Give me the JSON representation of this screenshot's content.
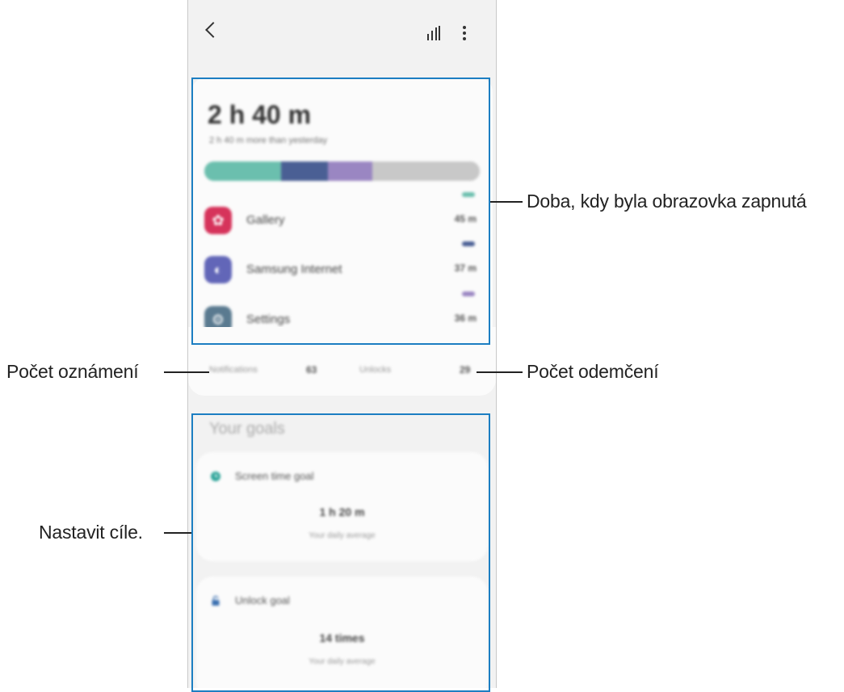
{
  "header": {
    "back_icon": "chevron-left-icon",
    "chart_icon": "bar-chart-icon",
    "more_icon": "more-vertical-icon"
  },
  "summary": {
    "total_time": "2 h 40 m",
    "comparison": "2 h 40 m more than yesterday",
    "usage_fractions": [
      0.28,
      0.17,
      0.16,
      0.39
    ],
    "segment_colors": [
      "#6bbfae",
      "#4a5f94",
      "#9a86c2",
      "#c8c8c8"
    ]
  },
  "apps": [
    {
      "name": "Gallery",
      "time": "45 m",
      "icon": "gallery-icon",
      "color": "#d6335b",
      "mark_color": "#6bbfae"
    },
    {
      "name": "Samsung Internet",
      "time": "37 m",
      "icon": "samsung-internet-icon",
      "color": "#6266b8",
      "mark_color": "#4a5f94"
    },
    {
      "name": "Settings",
      "time": "36 m",
      "icon": "settings-icon",
      "color": "#5a7a90",
      "mark_color": "#9a86c2"
    }
  ],
  "stats": {
    "notifications_label": "Notifications",
    "notifications_value": "63",
    "unlocks_label": "Unlocks",
    "unlocks_value": "29"
  },
  "goals": {
    "title": "Your goals",
    "screen_time": {
      "name": "Screen time goal",
      "value": "1 h 20 m",
      "sub": "Your daily average",
      "icon": "clock-icon"
    },
    "unlock": {
      "name": "Unlock goal",
      "value": "14 times",
      "sub": "Your daily average",
      "icon": "lock-icon"
    }
  },
  "callouts": {
    "screen_on": "Doba, kdy byla obrazovka zapnutá",
    "notifications": "Počet oznámení",
    "unlocks": "Počet odemčení",
    "goals": "Nastavit cíle."
  },
  "highlight_color": "#1c7ec2"
}
